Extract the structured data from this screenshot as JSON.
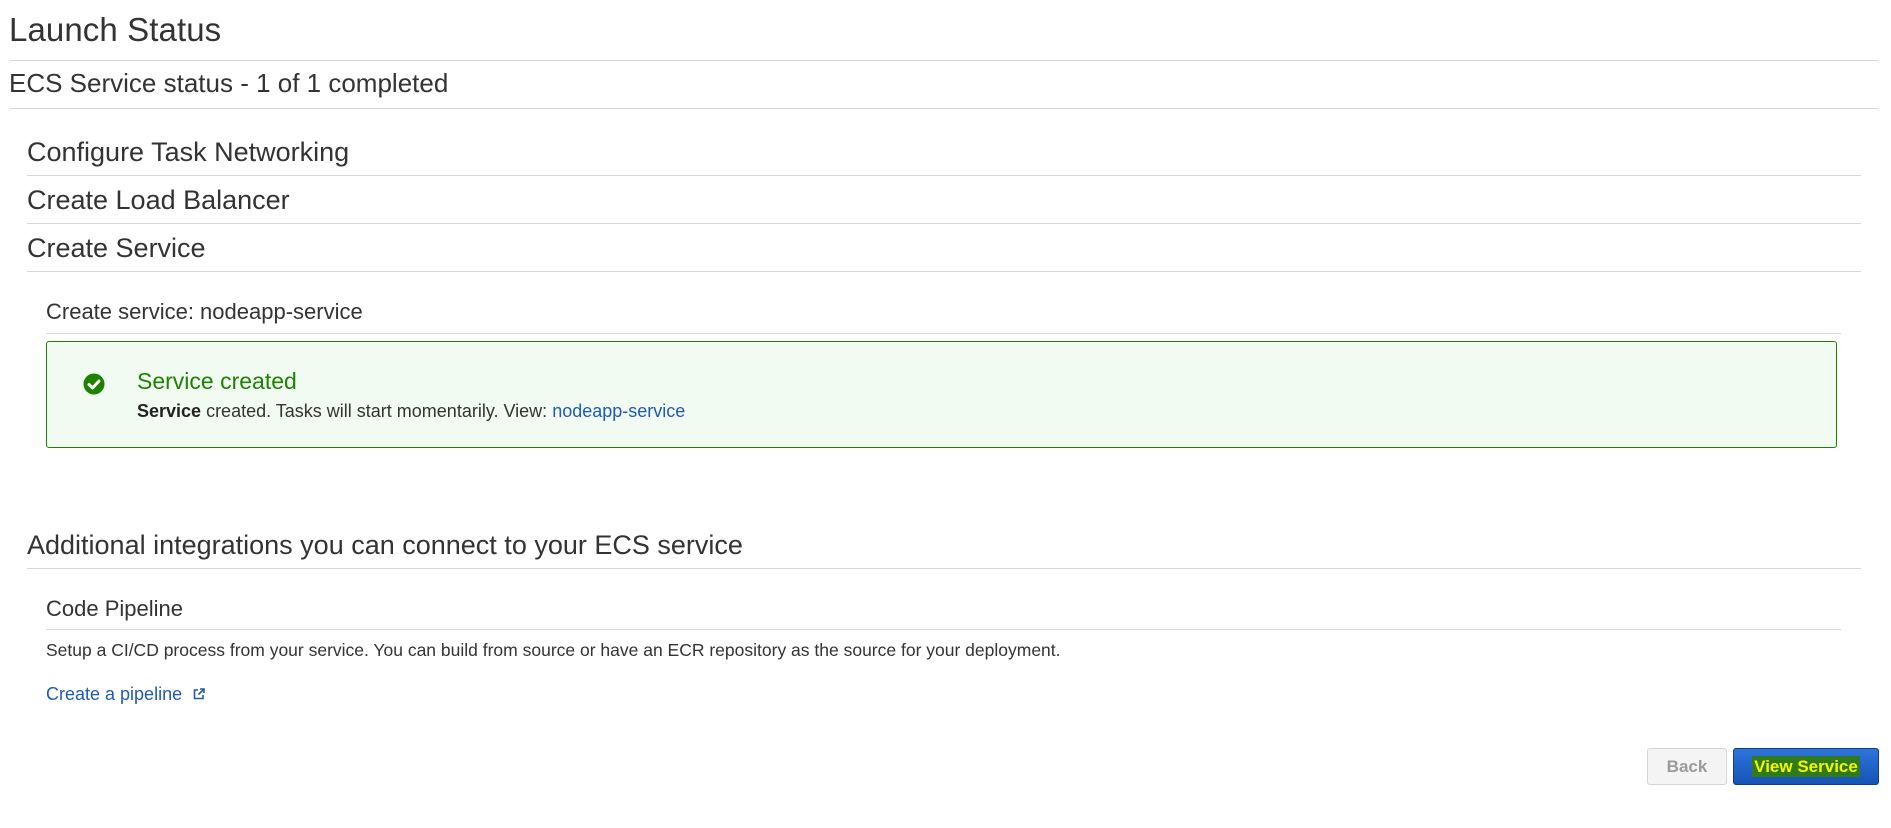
{
  "page": {
    "title": "Launch Status",
    "status": "ECS Service status - 1 of 1 completed"
  },
  "steps": [
    {
      "label": "Configure Task Networking"
    },
    {
      "label": "Create Load Balancer"
    },
    {
      "label": "Create Service"
    }
  ],
  "create_service": {
    "heading": "Create service: nodeapp-service",
    "alert": {
      "title": "Service created",
      "body_bold": "Service",
      "body_text": " created. Tasks will start momentarily. View: ",
      "link_text": "nodeapp-service",
      "color": "#1d8102"
    }
  },
  "integrations": {
    "heading": "Additional integrations you can connect to your ECS service",
    "code_pipeline": {
      "title": "Code Pipeline",
      "description": "Setup a CI/CD process from your service. You can build from source or have an ECR repository as the source for your deployment.",
      "link_text": "Create a pipeline",
      "link_icon": "external-link-icon"
    }
  },
  "footer": {
    "back_label": "Back",
    "view_label": "View Service"
  },
  "colors": {
    "link": "#1e5bb3",
    "primary_button": "#1d5fc4",
    "success": "#1d8102"
  }
}
